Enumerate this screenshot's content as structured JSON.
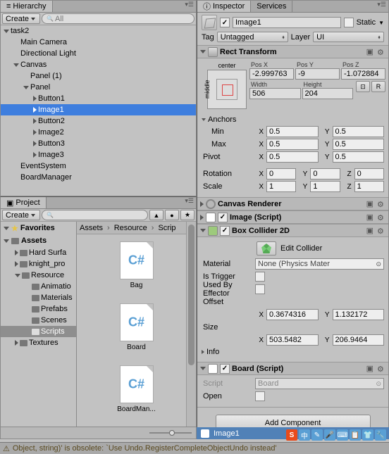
{
  "hierarchy": {
    "tab": "Hierarchy",
    "create": "Create",
    "search_placeholder": "All",
    "items": [
      {
        "name": "task2",
        "indent": 0,
        "fold": "open"
      },
      {
        "name": "Main Camera",
        "indent": 1,
        "fold": "none"
      },
      {
        "name": "Directional Light",
        "indent": 1,
        "fold": "none"
      },
      {
        "name": "Canvas",
        "indent": 1,
        "fold": "open"
      },
      {
        "name": "Panel (1)",
        "indent": 2,
        "fold": "none"
      },
      {
        "name": "Panel",
        "indent": 2,
        "fold": "open"
      },
      {
        "name": "Button1",
        "indent": 3,
        "fold": "closed"
      },
      {
        "name": "Image1",
        "indent": 3,
        "fold": "closed",
        "selected": true
      },
      {
        "name": "Button2",
        "indent": 3,
        "fold": "closed"
      },
      {
        "name": "Image2",
        "indent": 3,
        "fold": "closed"
      },
      {
        "name": "Button3",
        "indent": 3,
        "fold": "closed"
      },
      {
        "name": "Image3",
        "indent": 3,
        "fold": "closed"
      },
      {
        "name": "EventSystem",
        "indent": 1,
        "fold": "none"
      },
      {
        "name": "BoardManager",
        "indent": 1,
        "fold": "none"
      }
    ]
  },
  "project": {
    "tab": "Project",
    "create": "Create",
    "favorites": "Favorites",
    "assets_root": "Assets",
    "folders": [
      {
        "name": "Hard Surfa",
        "indent": 1,
        "fold": "closed"
      },
      {
        "name": "knight_pro",
        "indent": 1,
        "fold": "closed"
      },
      {
        "name": "Resource",
        "indent": 1,
        "fold": "open"
      },
      {
        "name": "Animatio",
        "indent": 2,
        "fold": "none"
      },
      {
        "name": "Materials",
        "indent": 2,
        "fold": "none"
      },
      {
        "name": "Prefabs",
        "indent": 2,
        "fold": "none"
      },
      {
        "name": "Scenes",
        "indent": 2,
        "fold": "none"
      },
      {
        "name": "Scripts",
        "indent": 2,
        "fold": "none",
        "selected": true
      },
      {
        "name": "Textures",
        "indent": 1,
        "fold": "closed"
      }
    ],
    "breadcrumb": [
      "Assets",
      "Resource",
      "Scrip"
    ],
    "assets": [
      {
        "name": "Bag"
      },
      {
        "name": "Board"
      },
      {
        "name": "BoardMan..."
      }
    ]
  },
  "inspector": {
    "tabs": {
      "inspector": "Inspector",
      "services": "Services"
    },
    "name": "Image1",
    "static_label": "Static",
    "tag_label": "Tag",
    "tag_value": "Untagged",
    "layer_label": "Layer",
    "layer_value": "UI",
    "rect": {
      "title": "Rect Transform",
      "anchor_top": "center",
      "anchor_left": "middle",
      "posx_l": "Pos X",
      "posy_l": "Pos Y",
      "posz_l": "Pos Z",
      "posx": "-2.999763",
      "posy": "-9",
      "posz": "-1.072884",
      "width_l": "Width",
      "height_l": "Height",
      "width": "506",
      "height": "204",
      "anchors": "Anchors",
      "min": "Min",
      "max": "Max",
      "pivot": "Pivot",
      "rotation": "Rotation",
      "scale": "Scale",
      "min_x": "0.5",
      "min_y": "0.5",
      "max_x": "0.5",
      "max_y": "0.5",
      "pivot_x": "0.5",
      "pivot_y": "0.5",
      "rot_x": "0",
      "rot_y": "0",
      "rot_z": "0",
      "scale_x": "1",
      "scale_y": "1",
      "scale_z": "1"
    },
    "canvas_renderer": "Canvas Renderer",
    "image_script": "Image (Script)",
    "box": {
      "title": "Box Collider 2D",
      "edit": "Edit Collider",
      "material": "Material",
      "material_val": "None (Physics Mater",
      "is_trigger": "Is Trigger",
      "used_by_effector": "Used By Effector",
      "offset": "Offset",
      "offset_x": "0.3674316",
      "offset_y": "1.132172",
      "size": "Size",
      "size_x": "503.5482",
      "size_y": "206.9464",
      "info": "Info"
    },
    "board": {
      "title": "Board (Script)",
      "script": "Script",
      "script_val": "Board",
      "open": "Open"
    },
    "add_component": "Add Component",
    "footer_asset": "Image1"
  },
  "status": "Object, string)' is obsolete: `Use Undo.RegisterCompleteObjectUndo instead'",
  "tray": [
    "S",
    "中",
    "✎",
    "🎤",
    "⌨",
    "📋",
    "👕",
    "🔧"
  ],
  "labels": {
    "x": "X",
    "y": "Y",
    "z": "Z"
  }
}
